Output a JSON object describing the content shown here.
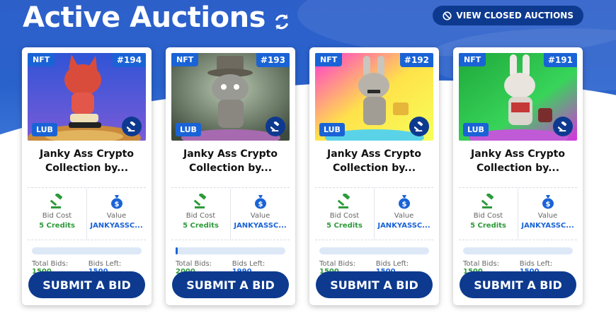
{
  "header": {
    "title": "Active Auctions",
    "closed_button_label": "VIEW CLOSED AUCTIONS"
  },
  "labels": {
    "nft_badge": "NFT",
    "token_badge": "LUB",
    "bid_cost_label": "Bid Cost",
    "value_label": "Value",
    "total_bids_label": "Total Bids:",
    "bids_left_label": "Bids Left:",
    "submit_label": "SUBMIT A BID"
  },
  "colors": {
    "brand_dark": "#0d3a8f",
    "brand": "#1a63d6",
    "green": "#2e9a3b"
  },
  "auctions": [
    {
      "number": "#194",
      "name": "Janky Ass Crypto Collection by...",
      "bid_cost": "5 Credits",
      "value": "JANKYASSC...",
      "total_bids": "1500",
      "bids_left": "1500",
      "progress_fraction": 0.0,
      "image": "red-cat-figure"
    },
    {
      "number": "#193",
      "name": "Janky Ass Crypto Collection by...",
      "bid_cost": "5 Credits",
      "value": "JANKYASSC...",
      "total_bids": "2000",
      "bids_left": "1990",
      "progress_fraction": 0.005,
      "image": "top-hat-cat-figure"
    },
    {
      "number": "#192",
      "name": "Janky Ass Crypto Collection by...",
      "bid_cost": "5 Credits",
      "value": "JANKYASSC...",
      "total_bids": "1500",
      "bids_left": "1500",
      "progress_fraction": 0.0,
      "image": "gray-bunny-figure"
    },
    {
      "number": "#191",
      "name": "Janky Ass Crypto Collection by...",
      "bid_cost": "5 Credits",
      "value": "JANKYASSC...",
      "total_bids": "1500",
      "bids_left": "1500",
      "progress_fraction": 0.0,
      "image": "white-red-bunny-figure"
    }
  ]
}
